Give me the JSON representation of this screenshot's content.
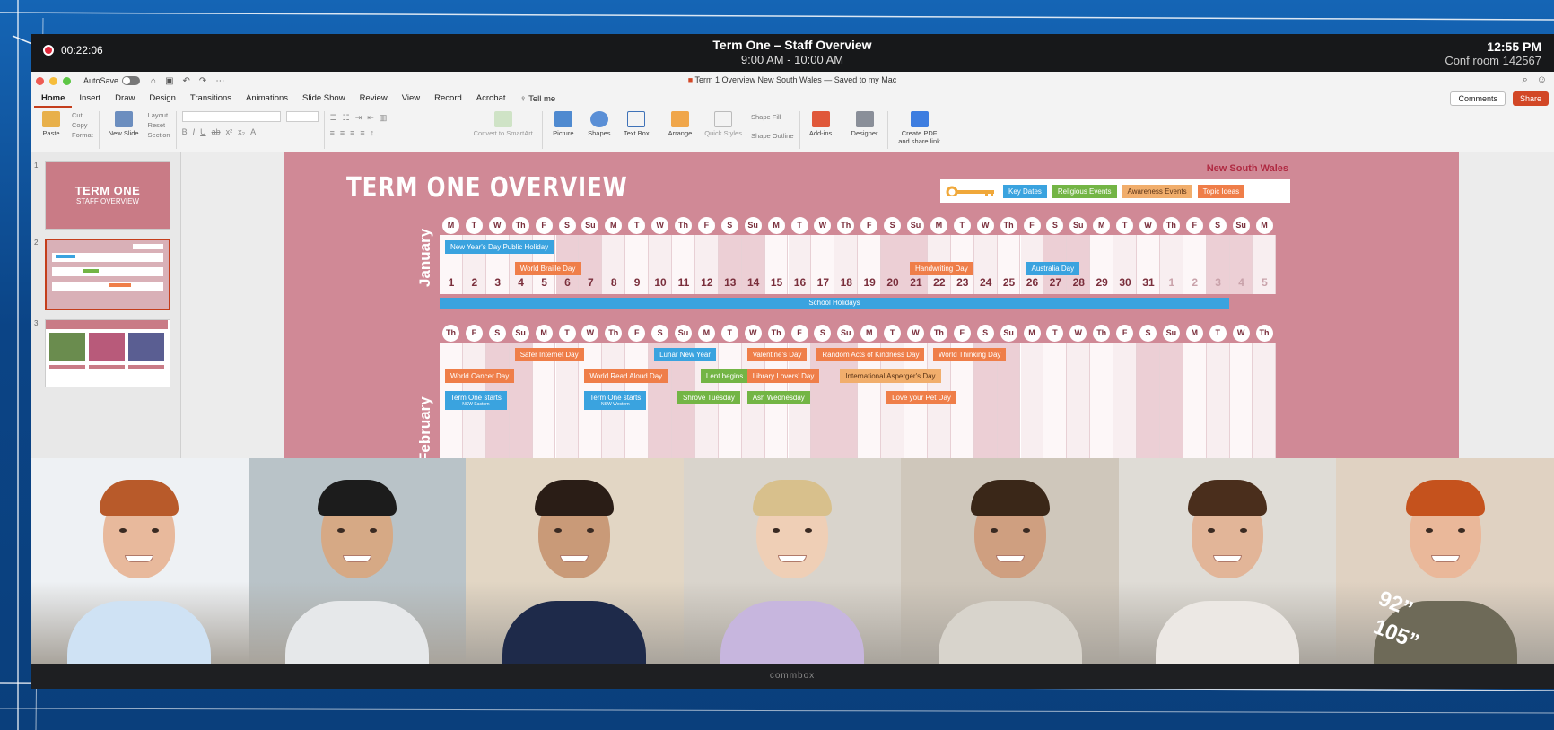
{
  "meeting": {
    "recording_time": "00:22:06",
    "title": "Term One – Staff Overview",
    "time_range": "9:00 AM - 10:00 AM",
    "clock": "12:55 PM",
    "room": "Conf room 142567"
  },
  "ppt": {
    "autosave_label": "AutoSave",
    "doc_title": "Term 1 Overview New South Wales — Saved to my Mac",
    "tabs": [
      "Home",
      "Insert",
      "Draw",
      "Design",
      "Transitions",
      "Animations",
      "Slide Show",
      "Review",
      "View",
      "Record",
      "Acrobat"
    ],
    "tell_me": "Tell me",
    "comments": "Comments",
    "share": "Share",
    "ribbon": {
      "paste": "Paste",
      "cut": "Cut",
      "copy": "Copy",
      "format": "Format",
      "new_slide": "New Slide",
      "layout": "Layout",
      "reset": "Reset",
      "section": "Section",
      "convert": "Convert to SmartArt",
      "picture": "Picture",
      "shapes": "Shapes",
      "textbox": "Text Box",
      "arrange": "Arrange",
      "quick_styles": "Quick Styles",
      "shape_fill": "Shape Fill",
      "shape_outline": "Shape Outline",
      "addins": "Add-ins",
      "designer": "Designer",
      "create_pdf": "Create PDF and share link"
    },
    "thumbs": {
      "slide1_title": "TERM ONE",
      "slide1_sub": "STAFF OVERVIEW",
      "nums": [
        "1",
        "2",
        "3"
      ]
    }
  },
  "slide": {
    "title": "TERM ONE OVERVIEW",
    "region": "New South Wales",
    "legend": [
      {
        "label": "Key Dates",
        "color": "#3aa3df"
      },
      {
        "label": "Religious Events",
        "color": "#73b545"
      },
      {
        "label": "Awareness Events",
        "color": "#f1ae6c"
      },
      {
        "label": "Topic Ideas",
        "color": "#ef7e49"
      }
    ],
    "january": {
      "label": "January",
      "days": [
        "M",
        "T",
        "W",
        "Th",
        "F",
        "S",
        "Su",
        "M",
        "T",
        "W",
        "Th",
        "F",
        "S",
        "Su",
        "M",
        "T",
        "W",
        "Th",
        "F",
        "S",
        "Su",
        "M",
        "T",
        "W",
        "Th",
        "F",
        "S",
        "Su",
        "M",
        "T",
        "W",
        "Th",
        "F",
        "S",
        "Su",
        "M"
      ],
      "dates": [
        "1",
        "2",
        "3",
        "4",
        "5",
        "6",
        "7",
        "8",
        "9",
        "10",
        "11",
        "12",
        "13",
        "14",
        "15",
        "16",
        "17",
        "18",
        "19",
        "20",
        "21",
        "22",
        "23",
        "24",
        "25",
        "26",
        "27",
        "28",
        "29",
        "30",
        "31",
        "1",
        "2",
        "3",
        "4",
        "5"
      ],
      "events": [
        {
          "label": "New Year's Day Public Holiday",
          "type": "key",
          "col": 0,
          "row": 0
        },
        {
          "label": "World Braille Day",
          "type": "top",
          "col": 3,
          "row": 1
        },
        {
          "label": "Handwriting Day",
          "type": "top",
          "col": 20,
          "row": 1
        },
        {
          "label": "Australia Day",
          "type": "key",
          "col": 25,
          "row": 1
        }
      ],
      "holidays": "School Holidays"
    },
    "february": {
      "label": "February",
      "days": [
        "Th",
        "F",
        "S",
        "Su",
        "M",
        "T",
        "W",
        "Th",
        "F",
        "S",
        "Su",
        "M",
        "T",
        "W",
        "Th",
        "F",
        "S",
        "Su",
        "M",
        "T",
        "W",
        "Th",
        "F",
        "S",
        "Su",
        "M",
        "T",
        "W",
        "Th",
        "F",
        "S",
        "Su",
        "M",
        "T",
        "W",
        "Th"
      ],
      "events": [
        {
          "label": "Safer Internet Day",
          "type": "top",
          "col": 3,
          "row": 0
        },
        {
          "label": "Lunar New Year",
          "type": "key",
          "col": 9,
          "row": 0
        },
        {
          "label": "Valentine's Day",
          "type": "top",
          "col": 13,
          "row": 0
        },
        {
          "label": "Random Acts of Kindness Day",
          "type": "top",
          "col": 16,
          "row": 0
        },
        {
          "label": "World Thinking Day",
          "type": "top",
          "col": 21,
          "row": 0
        },
        {
          "label": "World Cancer Day",
          "type": "top",
          "col": 0,
          "row": 1
        },
        {
          "label": "World Read Aloud Day",
          "type": "top",
          "col": 6,
          "row": 1
        },
        {
          "label": "Lent begins",
          "type": "rel",
          "col": 11,
          "row": 1
        },
        {
          "label": "Library Lovers' Day",
          "type": "top",
          "col": 13,
          "row": 1
        },
        {
          "label": "International Asperger's Day",
          "type": "awr",
          "col": 17,
          "row": 1
        },
        {
          "label": "Term One starts",
          "sub": "NSW Eastern",
          "type": "key",
          "col": 0,
          "row": 2
        },
        {
          "label": "Term One starts",
          "sub": "NSW Western",
          "type": "key",
          "col": 6,
          "row": 2
        },
        {
          "label": "Shrove Tuesday",
          "type": "rel",
          "col": 10,
          "row": 2
        },
        {
          "label": "Ash Wednesday",
          "type": "rel",
          "col": 13,
          "row": 2
        },
        {
          "label": "Love your Pet Day",
          "type": "top",
          "col": 19,
          "row": 2
        }
      ]
    }
  },
  "participants": [
    {
      "name": "participant-1",
      "bg": "#eef1f4",
      "skin": "#e8b99c",
      "hair": "#b85a2a",
      "shirt": "#cfe2f4"
    },
    {
      "name": "participant-2",
      "bg": "#b9c3c8",
      "skin": "#d6a985",
      "hair": "#1c1c1c",
      "shirt": "#e6e8ea"
    },
    {
      "name": "participant-3",
      "bg": "#e2d6c4",
      "skin": "#c99a78",
      "hair": "#2a1d16",
      "shirt": "#1e2a4a"
    },
    {
      "name": "participant-4",
      "bg": "#d9d4cc",
      "skin": "#efcfb6",
      "hair": "#d8c08c",
      "shirt": "#c7b6de"
    },
    {
      "name": "participant-5",
      "bg": "#cfc7bb",
      "skin": "#cf9f80",
      "hair": "#3a2718",
      "shirt": "#d8d4cc"
    },
    {
      "name": "participant-6",
      "bg": "#dfdcd6",
      "skin": "#e2b598",
      "hair": "#4a2e1c",
      "shirt": "#ece8e4"
    },
    {
      "name": "participant-7",
      "bg": "#e0d2c2",
      "skin": "#eab89a",
      "hair": "#c5521d",
      "shirt": "#6e6a58"
    }
  ],
  "display": {
    "brand": "commbox",
    "size_a": "92”",
    "size_b": "105”"
  }
}
